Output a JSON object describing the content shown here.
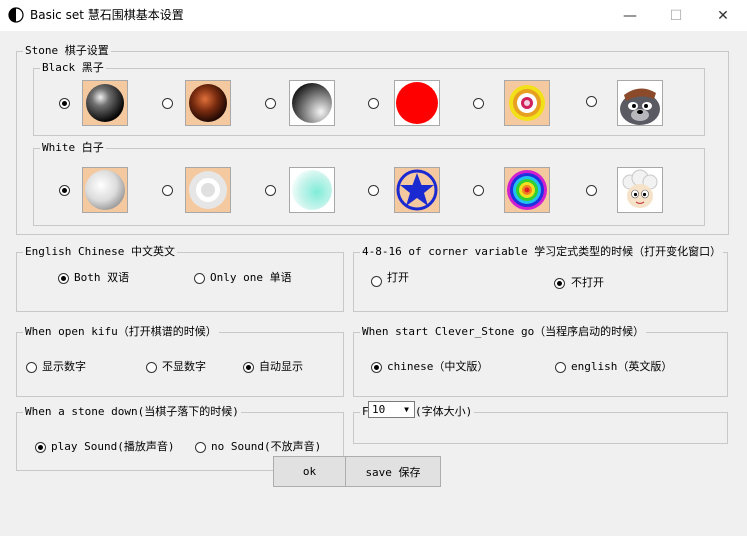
{
  "window": {
    "title": "Basic set 慧石围棋基本设置",
    "minimize_glyph": "—",
    "maximize_glyph": "☐",
    "close_glyph": "✕"
  },
  "stone": {
    "legend": "Stone 棋子设置",
    "black": {
      "legend": "Black 黑子",
      "selected_index": 0,
      "options": [
        "black-glossy-stone-icon",
        "brown-glossy-stone-icon",
        "gray-gradient-stone-icon",
        "red-stone-icon",
        "target-rings-stone-icon",
        "gray-wolf-cartoon-icon"
      ]
    },
    "white": {
      "legend": "White 白子",
      "selected_index": 0,
      "options": [
        "white-glossy-stone-icon",
        "white-ring-stone-icon",
        "mint-gradient-stone-icon",
        "blue-star-stone-icon",
        "rainbow-rings-stone-icon",
        "sheep-cartoon-icon"
      ]
    }
  },
  "language": {
    "legend": "English Chinese  中文英文",
    "options": [
      {
        "label": "Both 双语",
        "checked": true
      },
      {
        "label": "Only one 单语",
        "checked": false
      }
    ]
  },
  "corner": {
    "legend": "4-8-16 of corner variable 学习定式类型的时候（打开变化窗口）",
    "options": [
      {
        "label": "打开",
        "checked": false
      },
      {
        "label": "不打开",
        "checked": true
      }
    ]
  },
  "kifu": {
    "legend": "When open kifu（打开棋谱的时候）",
    "options": [
      {
        "label": "显示数字",
        "checked": false
      },
      {
        "label": "不显数字",
        "checked": false
      },
      {
        "label": "自动显示",
        "checked": true
      }
    ]
  },
  "startup": {
    "legend": "When start Clever_Stone go（当程序启动的时候）",
    "options": [
      {
        "label": "chinese（中文版）",
        "checked": true
      },
      {
        "label": "english（英文版）",
        "checked": false
      }
    ]
  },
  "sound": {
    "legend": "When a stone down(当棋子落下的时候)",
    "options": [
      {
        "label": "play Sound(播放声音)",
        "checked": true
      },
      {
        "label": "no Sound(不放声音)",
        "checked": false
      }
    ]
  },
  "fontsize": {
    "legend": "Fontzise(字体大小)",
    "value": "10",
    "arrow_glyph": "▼"
  },
  "buttons": {
    "ok": "ok",
    "save": "save 保存"
  },
  "colors": {
    "dialog_bg": "#f0f0f0",
    "thumb_bg": "#f5c9a0",
    "group_border": "#c8c8c8",
    "button_bg": "#e1e1e1"
  }
}
